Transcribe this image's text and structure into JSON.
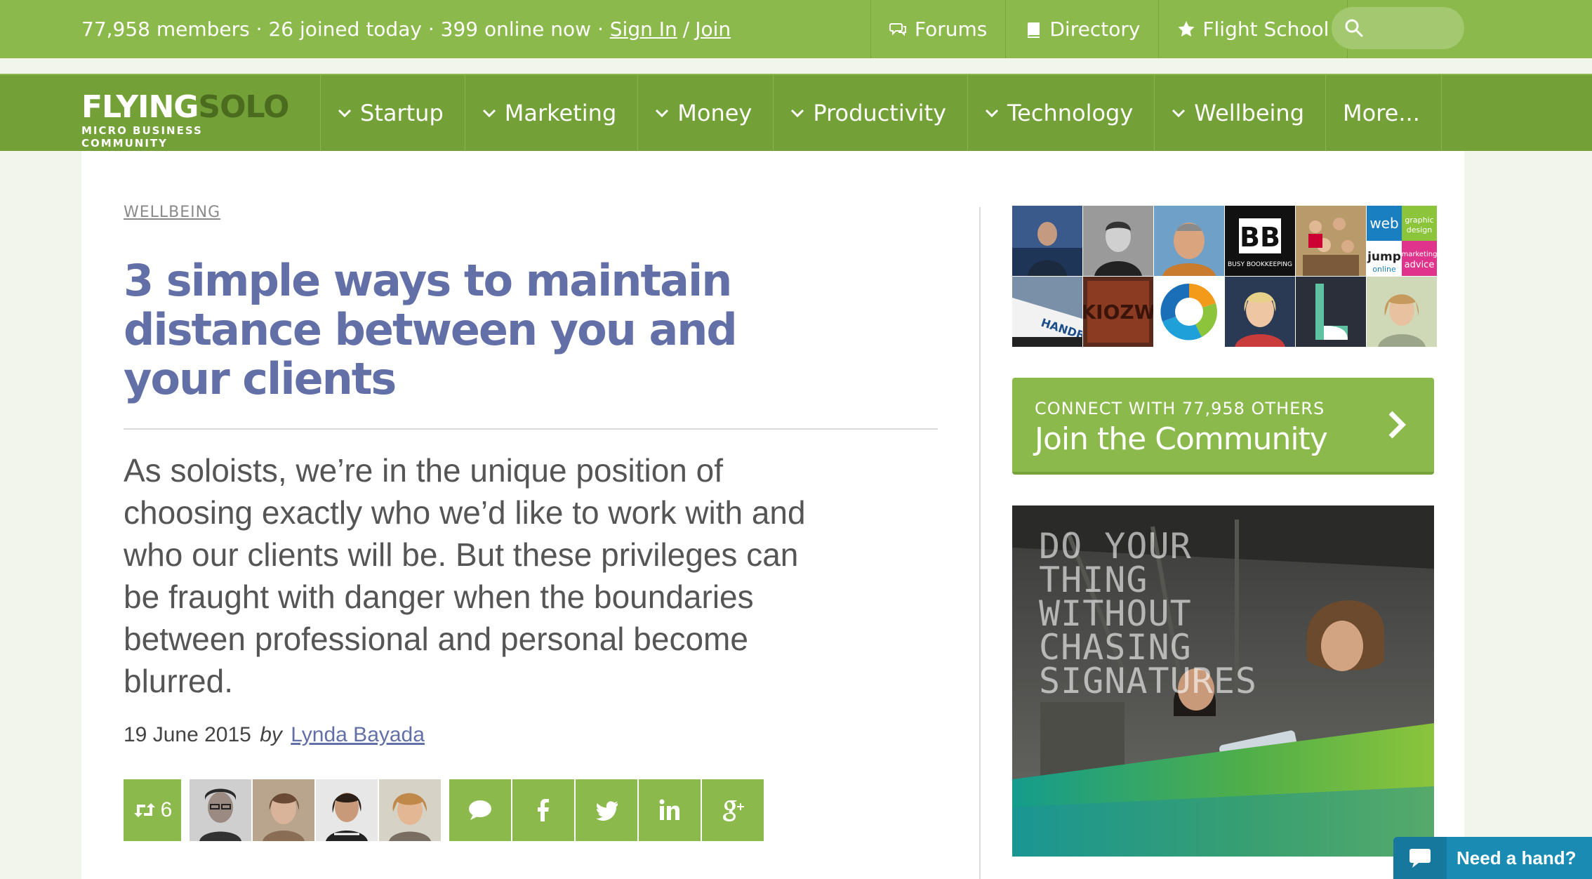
{
  "topbar": {
    "stats": "77,958 members · 26 joined today · 399 online now ·",
    "sign_in": "Sign In",
    "slash": "/",
    "join": "Join",
    "links": [
      {
        "label": "Forums",
        "icon": "speech-bubbles-icon"
      },
      {
        "label": "Directory",
        "icon": "book-icon"
      },
      {
        "label": "Flight School",
        "icon": "star-icon"
      }
    ],
    "search_placeholder": ""
  },
  "logo": {
    "part1": "FLYING",
    "part2": "SOLO",
    "tagline": "MICRO BUSINESS COMMUNITY"
  },
  "nav": {
    "items": [
      {
        "label": "Startup"
      },
      {
        "label": "Marketing"
      },
      {
        "label": "Money"
      },
      {
        "label": "Productivity"
      },
      {
        "label": "Technology"
      },
      {
        "label": "Wellbeing"
      },
      {
        "label": "More..."
      }
    ]
  },
  "article": {
    "category": "WELLBEING",
    "title": "3 simple ways to maintain distance between you and your clients",
    "lede": "As soloists, we’re in the unique position of choosing exactly who we’d like to work with and who our clients will be. But these privileges can be fraught with danger when the boundaries between professional and personal become blurred.",
    "date": "19 June 2015",
    "by": "by",
    "author": "Lynda Bayada",
    "reshare_count": "6"
  },
  "sidebar": {
    "join_small": "CONNECT WITH 77,958 OTHERS",
    "join_big": "Join the Community",
    "ad_lines": [
      "DO YOUR",
      "THING WITHOUT",
      "CHASING",
      "SIGNATURES"
    ]
  },
  "help": {
    "label": "Need a hand?"
  },
  "colors": {
    "brand_green": "#8cb94c",
    "nav_green": "#73a037",
    "title_blue": "#6370a8",
    "help_blue": "#1a8bb3"
  }
}
